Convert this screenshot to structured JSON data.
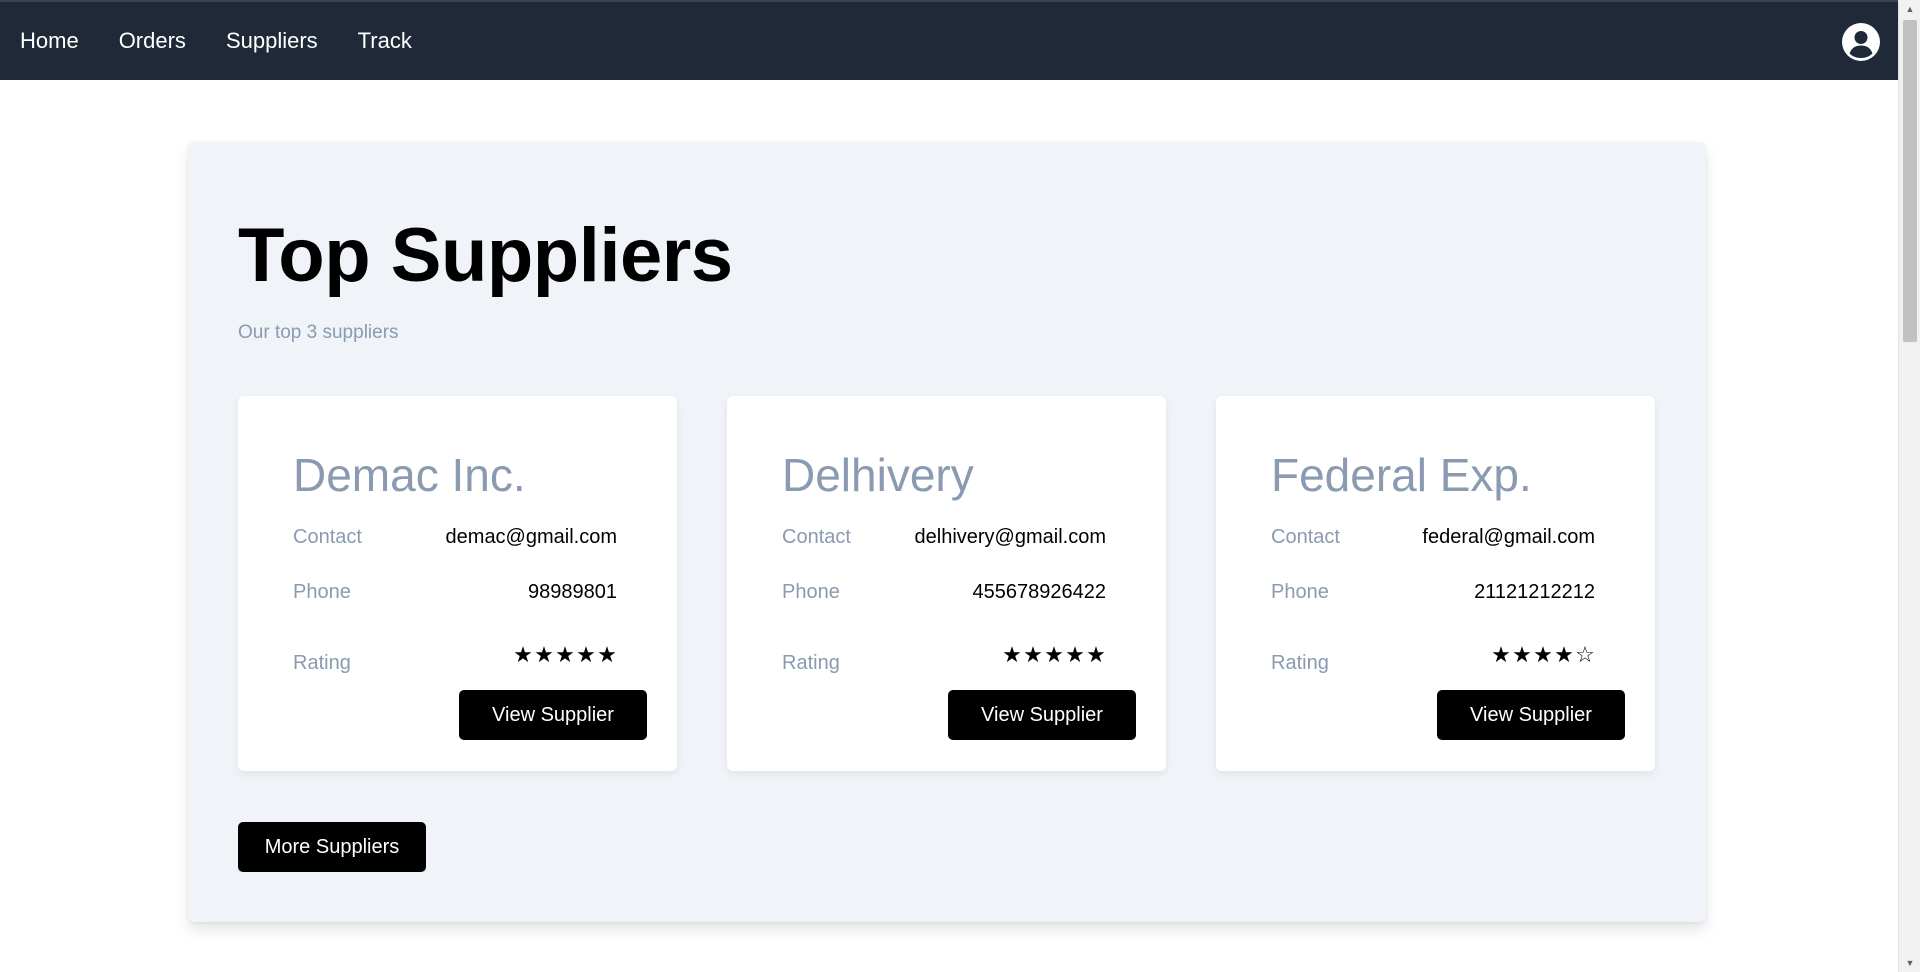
{
  "nav": {
    "items": [
      {
        "label": "Home"
      },
      {
        "label": "Orders"
      },
      {
        "label": "Suppliers"
      },
      {
        "label": "Track"
      }
    ],
    "avatar_icon": "user-circle-icon"
  },
  "main": {
    "title": "Top Suppliers",
    "subtitle": "Our top 3 suppliers",
    "more_button_label": "More Suppliers",
    "field_labels": {
      "contact": "Contact",
      "phone": "Phone",
      "rating": "Rating"
    },
    "suppliers": [
      {
        "name": "Demac Inc.",
        "contact": "demac@gmail.com",
        "phone": "98989801",
        "rating": 5,
        "rating_max": 5,
        "button_label": "View Supplier"
      },
      {
        "name": "Delhivery",
        "contact": "delhivery@gmail.com",
        "phone": "455678926422",
        "rating": 5,
        "rating_max": 5,
        "button_label": "View Supplier"
      },
      {
        "name": "Federal Exp.",
        "contact": "federal@gmail.com",
        "phone": "21121212212",
        "rating": 4,
        "rating_max": 5,
        "button_label": "View Supplier"
      }
    ]
  },
  "colors": {
    "navbar_bg": "#1f2937",
    "panel_bg": "#f0f4f8",
    "muted_text": "#8a9ab1",
    "button_bg": "#000000"
  }
}
